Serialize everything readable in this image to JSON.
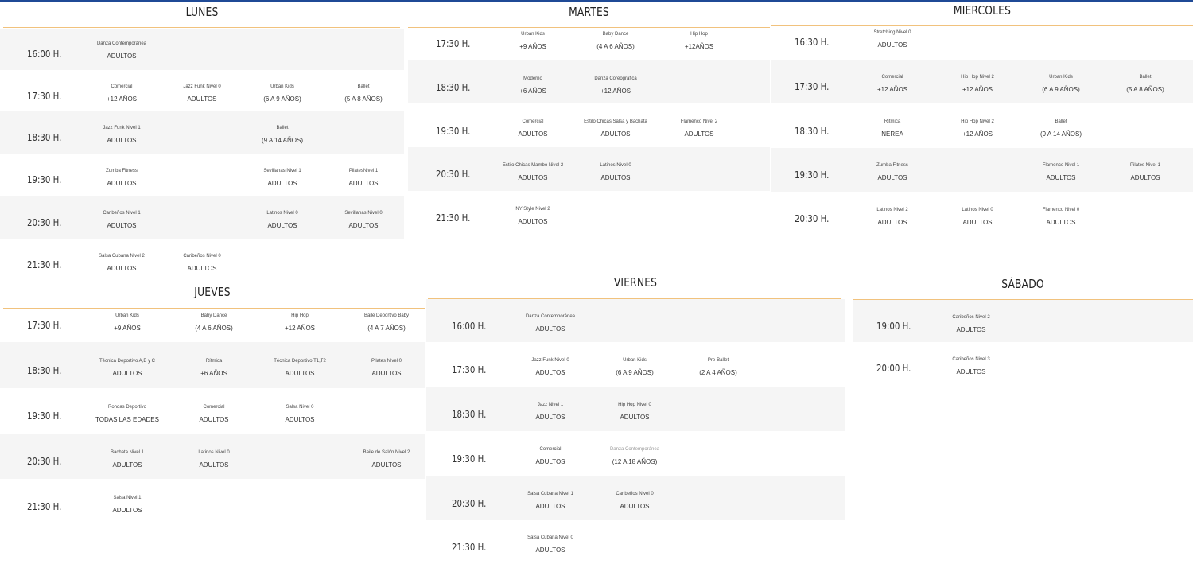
{
  "lunes": {
    "title": "LUNES",
    "rows": [
      {
        "time": "16:00 H.",
        "classes": [
          {
            "name": "Danza Contemporánea",
            "level": "ADULTOS"
          }
        ]
      },
      {
        "time": "17:30 H.",
        "classes": [
          {
            "name": "Comercial",
            "level": "+12 AÑOS"
          },
          {
            "name": "Jazz Funk Nivel 0",
            "level": "ADULTOS"
          },
          {
            "name": "Urban Kids",
            "level": "(6 A 9 AÑOS)"
          },
          {
            "name": "Ballet",
            "level": "(5 A 8 AÑOS)"
          }
        ]
      },
      {
        "time": "18:30 H.",
        "classes": [
          {
            "name": "Jazz Funk Nivel 1",
            "level": "ADULTOS"
          },
          {
            "name": "Ballet",
            "level": "(9 A 14 AÑOS)"
          }
        ]
      },
      {
        "time": "19:30 H.",
        "classes": [
          {
            "name": "Zumba Fitness",
            "level": "ADULTOS"
          },
          {
            "name": "Sevillanas Nivel 1",
            "level": "ADULTOS"
          },
          {
            "name": "PilatesNivel 1",
            "level": "ADULTOS"
          }
        ]
      },
      {
        "time": "20:30 H.",
        "classes": [
          {
            "name": "Caribeños Nivel 1",
            "level": "ADULTOS"
          },
          {
            "name": "Latinos Nivel 0",
            "level": "ADULTOS"
          },
          {
            "name": "Sevillanas Nivel 0",
            "level": "ADULTOS"
          }
        ]
      },
      {
        "time": "21:30 H.",
        "classes": [
          {
            "name": "Salsa Cubana Nivel 2",
            "level": "ADULTOS"
          },
          {
            "name": "Caribeños Nivel 0",
            "level": "ADULTOS"
          }
        ]
      }
    ]
  },
  "martes": {
    "title": "MARTES",
    "rows": [
      {
        "time": "17:30 H.",
        "classes": [
          {
            "name": "Urban Kids",
            "level": "+9 AÑOS"
          },
          {
            "name": "Baby Dance",
            "level": "(4 A 6 AÑOS)"
          },
          {
            "name": "Hip Hop",
            "level": "+12AÑOS"
          }
        ]
      },
      {
        "time": "18:30 H.",
        "classes": [
          {
            "name": "Moderno",
            "level": "+6 AÑOS"
          },
          {
            "name": "Danza Coreográfica",
            "level": "+12 AÑOS"
          }
        ]
      },
      {
        "time": "19:30 H.",
        "classes": [
          {
            "name": "Comercial",
            "level": "ADULTOS"
          },
          {
            "name": "Estilo Chicas Salsa y Bachata",
            "level": "ADULTOS"
          },
          {
            "name": "Flamenco Nivel 2",
            "level": "ADULTOS"
          }
        ]
      },
      {
        "time": "20:30 H.",
        "classes": [
          {
            "name": "Estilo Chicas Mambo Nivel 2",
            "level": "ADULTOS"
          },
          {
            "name": "Latinos Nivel 0",
            "level": "ADULTOS"
          }
        ]
      },
      {
        "time": "21:30 H.",
        "classes": [
          {
            "name": "NY Style Nivel 2",
            "level": "ADULTOS"
          }
        ]
      }
    ]
  },
  "miercoles": {
    "title": "MIERCOLES",
    "rows": [
      {
        "time": "16:30 H.",
        "classes": [
          {
            "name": "Stretching Nivel 0",
            "level": "ADULTOS"
          }
        ]
      },
      {
        "time": "17:30 H.",
        "classes": [
          {
            "name": "Comercial",
            "level": "+12 AÑOS"
          },
          {
            "name": "Hip Hop Nivel 2",
            "level": "+12 AÑOS"
          },
          {
            "name": "Urban Kids",
            "level": "(6 A 9 AÑOS)"
          },
          {
            "name": "Ballet",
            "level": "(5 A 8 AÑOS)"
          }
        ]
      },
      {
        "time": "18:30 H.",
        "classes": [
          {
            "name": "Rítmica",
            "level": "NEREA"
          },
          {
            "name": "Hip Hop Nivel 2",
            "level": "+12 AÑOS"
          },
          {
            "name": "Ballet",
            "level": "(9 A 14 AÑOS)"
          }
        ]
      },
      {
        "time": "19:30 H.",
        "classes": [
          {
            "name": "Zumba Fitness",
            "level": "ADULTOS"
          },
          {
            "name": "Flamenco Nivel 1",
            "level": "ADULTOS"
          },
          {
            "name": "Pilates Nivel 1",
            "level": "ADULTOS"
          }
        ]
      },
      {
        "time": "20:30 H.",
        "classes": [
          {
            "name": "Latinos Nivel 2",
            "level": "ADULTOS"
          },
          {
            "name": "Latinos Nivel 0",
            "level": "ADULTOS"
          },
          {
            "name": "Flamenco Nivel 0",
            "level": "ADULTOS"
          }
        ]
      }
    ]
  },
  "jueves": {
    "title": "JUEVES",
    "rows": [
      {
        "time": "17:30 H.",
        "classes": [
          {
            "name": "Urban Kids",
            "level": "+9 AÑOS"
          },
          {
            "name": "Baby Dance",
            "level": "(4 A 6 AÑOS)"
          },
          {
            "name": "Hip Hop",
            "level": "+12 AÑOS"
          },
          {
            "name": "Baile Deportivo Baby",
            "level": "(4 A 7 AÑOS)"
          }
        ]
      },
      {
        "time": "18:30 H.",
        "classes": [
          {
            "name": "Técnica Deportivo A,B y C",
            "level": "ADULTOS"
          },
          {
            "name": "Rítmica",
            "level": "+6 AÑOS"
          },
          {
            "name": "Técnica Deportivo T1,T2",
            "level": "ADULTOS"
          },
          {
            "name": "Pilates Nivel 0",
            "level": "ADULTOS"
          }
        ]
      },
      {
        "time": "19:30 H.",
        "classes": [
          {
            "name": "Rondas Deportivo",
            "level": "TODAS LAS EDADES"
          },
          {
            "name": "Comercial",
            "level": "ADULTOS"
          },
          {
            "name": "Salsa Nivel 0",
            "level": "ADULTOS"
          }
        ]
      },
      {
        "time": "20:30 H.",
        "classes": [
          {
            "name": "Bachata Nivel 1",
            "level": "ADULTOS"
          },
          {
            "name": "Latinos Nivel 0",
            "level": "ADULTOS"
          },
          {
            "name": "Baile de Salón Nivel 2",
            "level": "ADULTOS"
          }
        ]
      },
      {
        "time": "21:30 H.",
        "classes": [
          {
            "name": "Salsa Nivel 1",
            "level": "ADULTOS"
          }
        ]
      }
    ]
  },
  "viernes": {
    "title": "VIERNES",
    "rows": [
      {
        "time": "16:00 H.",
        "classes": [
          {
            "name": "Danza Contemporánea",
            "level": "ADULTOS"
          }
        ]
      },
      {
        "time": "17:30 H.",
        "classes": [
          {
            "name": "Jazz Funk Nivel 0",
            "level": "ADULTOS"
          },
          {
            "name": "Urban Kids",
            "level": "(6 A 9 AÑOS)"
          },
          {
            "name": "Pre-Ballet",
            "level": "(2 A 4 AÑOS)"
          }
        ]
      },
      {
        "time": "18:30 H.",
        "classes": [
          {
            "name": "Jazz Nivel 1",
            "level": "ADULTOS"
          },
          {
            "name": "Hip Hop Nivel 0",
            "level": "ADULTOS"
          }
        ]
      },
      {
        "time": "19:30 H.",
        "classes": [
          {
            "name": "Comercial",
            "level": "ADULTOS"
          },
          {
            "name": "Danza Contemporánea",
            "level": "(12 A 18 AÑOS)"
          }
        ]
      },
      {
        "time": "20:30 H.",
        "classes": [
          {
            "name": "Salsa Cubana Nivel 1",
            "level": "ADULTOS"
          },
          {
            "name": "Caribeños Nivel 0",
            "level": "ADULTOS"
          }
        ]
      },
      {
        "time": "21:30 H.",
        "classes": [
          {
            "name": "Salsa Cubana Nivel 0",
            "level": "ADULTOS"
          }
        ]
      }
    ]
  },
  "sabado": {
    "title": "SÁBADO",
    "rows": [
      {
        "time": "19:00 H.",
        "classes": [
          {
            "name": "Caribeños Nivel 2",
            "level": "ADULTOS"
          }
        ]
      },
      {
        "time": "20:00 H.",
        "classes": [
          {
            "name": "Caribeños Nivel 3",
            "level": "ADULTOS"
          }
        ]
      }
    ]
  }
}
